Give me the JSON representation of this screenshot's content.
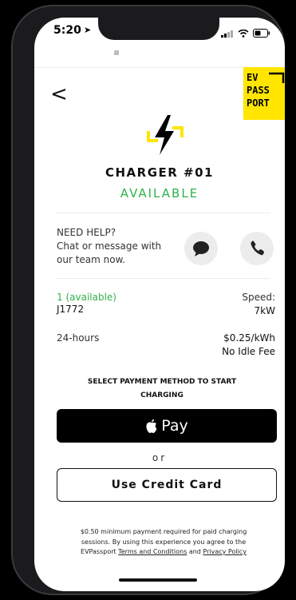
{
  "status_bar": {
    "time": "5:20"
  },
  "nav": {
    "back": "<"
  },
  "logo": {
    "text": "EV\nPASS\nPORT"
  },
  "charger": {
    "title": "CHARGER #01",
    "status": "AVAILABLE"
  },
  "help": {
    "title": "NEED HELP?",
    "subtitle": "Chat or message with our team now."
  },
  "details": {
    "availability": "1 (available)",
    "connector": "J1772",
    "speed_label": "Speed:",
    "speed_value": "7kW",
    "hours": "24-hours",
    "price": "$0.25/kWh",
    "idle_fee": "No Idle Fee"
  },
  "payment": {
    "instruction": "SELECT PAYMENT METHOD TO START CHARGING",
    "apple_pay_label": "Pay",
    "or": "or",
    "credit_card_label": "Use Credit Card"
  },
  "footer": {
    "text_before": "$0.50 minimum payment required for paid charging sessions. By using this experience you agree to the EVPassport",
    "terms_link": "Terms and Conditions",
    "and": "and",
    "privacy_link": "Privacy Policy"
  },
  "colors": {
    "accent_yellow": "#FFE500",
    "available_green": "#2FB24B"
  }
}
